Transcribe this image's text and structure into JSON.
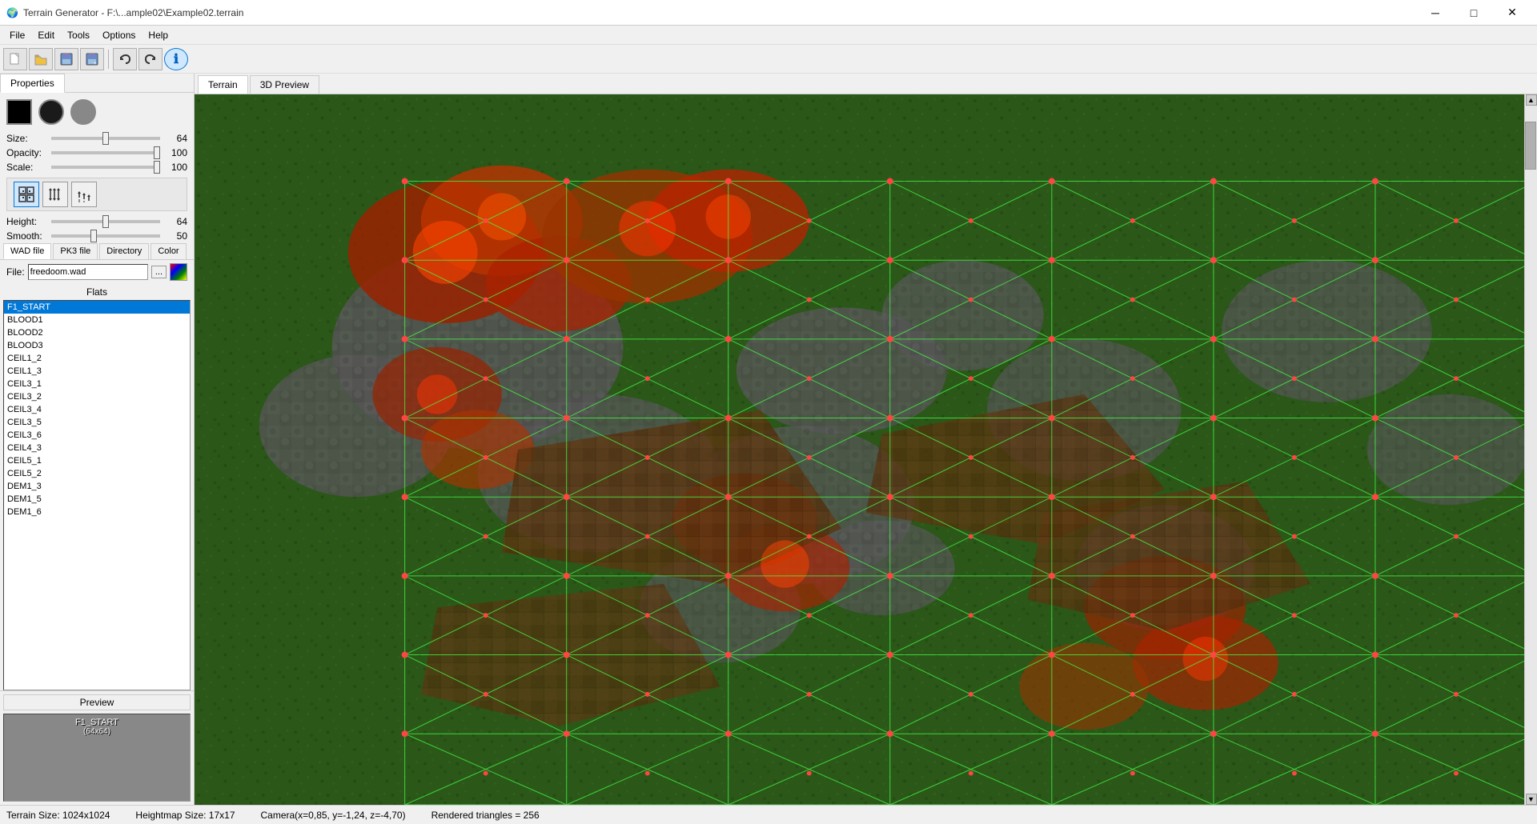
{
  "titlebar": {
    "icon": "🌍",
    "title": "Terrain Generator - F:\\...ample02\\Example02.terrain",
    "minimize": "─",
    "maximize": "□",
    "close": "✕"
  },
  "menu": {
    "items": [
      "File",
      "Edit",
      "Tools",
      "Options",
      "Help"
    ]
  },
  "toolbar": {
    "buttons": [
      {
        "name": "new",
        "icon": "📄"
      },
      {
        "name": "open",
        "icon": "📂"
      },
      {
        "name": "save",
        "icon": "💾"
      },
      {
        "name": "save-as",
        "icon": "📥"
      },
      {
        "name": "undo",
        "icon": "↩"
      },
      {
        "name": "redo",
        "icon": "↪"
      },
      {
        "name": "info",
        "icon": "ℹ"
      }
    ]
  },
  "properties": {
    "tab_label": "Properties"
  },
  "brush": {
    "shape_solid": "■",
    "shape_circle": "●",
    "shape_feather": "◉"
  },
  "size_slider": {
    "label": "Size:",
    "value": "64",
    "percent": 50
  },
  "opacity_slider": {
    "label": "Opacity:",
    "value": "100",
    "percent": 100
  },
  "scale_slider": {
    "label": "Scale:",
    "value": "100",
    "percent": 100
  },
  "height_slider": {
    "label": "Height:",
    "value": "64",
    "percent": 50
  },
  "smooth_slider": {
    "label": "Smooth:",
    "value": "50",
    "percent": 38
  },
  "texture_tabs": {
    "tabs": [
      "WAD file",
      "PK3 file",
      "Directory",
      "Color"
    ]
  },
  "file": {
    "label": "File:",
    "value": "freedoom.wad",
    "browse_btn": "...",
    "color_btn": "🎨"
  },
  "flats": {
    "header": "Flats",
    "items": [
      "F1_START",
      "BLOOD1",
      "BLOOD2",
      "BLOOD3",
      "CEIL1_2",
      "CEIL1_3",
      "CEIL3_1",
      "CEIL3_2",
      "CEIL3_4",
      "CEIL3_5",
      "CEIL3_6",
      "CEIL4_3",
      "CEIL5_1",
      "CEIL5_2",
      "DEM1_3",
      "DEM1_5",
      "DEM1_6"
    ],
    "selected_index": 0
  },
  "preview": {
    "header": "Preview",
    "name": "F1_START",
    "size": "(64x64)"
  },
  "view_tabs": {
    "tabs": [
      "Terrain",
      "3D Preview"
    ],
    "active": "Terrain"
  },
  "statusbar": {
    "terrain_size": "Terrain Size: 1024x1024",
    "heightmap_size": "Heightmap Size: 17x17",
    "camera": "Camera(x=0,85, y=-1,24, z=-4,70)",
    "triangles": "Rendered triangles = 256"
  }
}
